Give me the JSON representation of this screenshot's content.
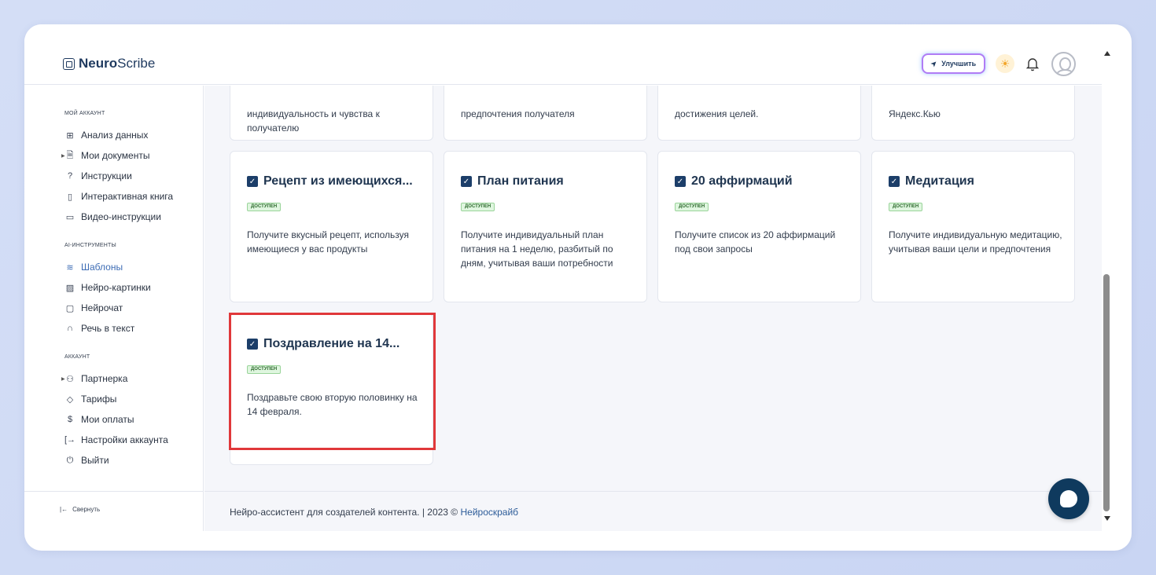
{
  "app": {
    "logo_bold": "Neuro",
    "logo_rest": "Scribe"
  },
  "header": {
    "upgrade_label": "Улучшить"
  },
  "sidebar": {
    "sections": [
      {
        "title": "МОЙ АККАУНТ",
        "items": [
          "Анализ данных",
          "Мои документы",
          "Инструкции",
          "Интерактивная книга",
          "Видео-инструкции"
        ]
      },
      {
        "title": "AI-ИНСТРУМЕНТЫ",
        "items": [
          "Шаблоны",
          "Нейро-картинки",
          "Нейрочат",
          "Речь в текст"
        ]
      },
      {
        "title": "АККАУНТ",
        "items": [
          "Партнерка",
          "Тарифы",
          "Мои оплаты",
          "Настройки аккаунта",
          "Выйти"
        ]
      }
    ],
    "active_item": "Шаблоны",
    "collapse_label": "Свернуть"
  },
  "top_cards": [
    {
      "desc": "индивидуальность и чувства к получателю"
    },
    {
      "desc": "предпочтения получателя"
    },
    {
      "desc": "достижения целей."
    },
    {
      "desc": "Яндекс.Кью"
    }
  ],
  "cards": [
    {
      "title": "Рецепт из имеющихся...",
      "badge": "ДОСТУПЕН",
      "desc": "Получите вкусный рецепт, используя имеющиеся у вас продукты"
    },
    {
      "title": "План питания",
      "badge": "ДОСТУПЕН",
      "desc": "Получите индивидуальный план питания на 1 неделю, разбитый по дням, учитывая ваши потребности"
    },
    {
      "title": "20 аффирмаций",
      "badge": "ДОСТУПЕН",
      "desc": "Получите список из 20 аффирмаций под свои запросы"
    },
    {
      "title": "Медитация",
      "badge": "ДОСТУПЕН",
      "desc": "Получите индивидуальную медитацию, учитывая ваши цели и предпочтения"
    },
    {
      "title": "Поздравление на 14...",
      "badge": "ДОСТУПЕН",
      "desc": "Поздравьте свою вторую половинку на 14 февраля."
    }
  ],
  "footer": {
    "text": "Нейро-ассистент для создателей контента.  | 2023 © ",
    "link": "Нейроскрайб"
  },
  "colors": {
    "accent": "#3e6db5",
    "highlight": "#e0383a",
    "chat": "#0f3a5e",
    "badge_bg": "#dff6df"
  },
  "icons": {
    "sidebar": [
      "grid-icon",
      "document-icon",
      "question-circle-icon",
      "book-icon",
      "video-icon",
      "layers-icon",
      "image-icon",
      "chat-bubble-icon",
      "headphones-icon",
      "users-icon",
      "tag-icon",
      "dollar-icon",
      "login-arrow-icon",
      "power-icon"
    ],
    "header": [
      "rocket-icon",
      "sun-icon",
      "bell-icon",
      "avatar"
    ]
  }
}
